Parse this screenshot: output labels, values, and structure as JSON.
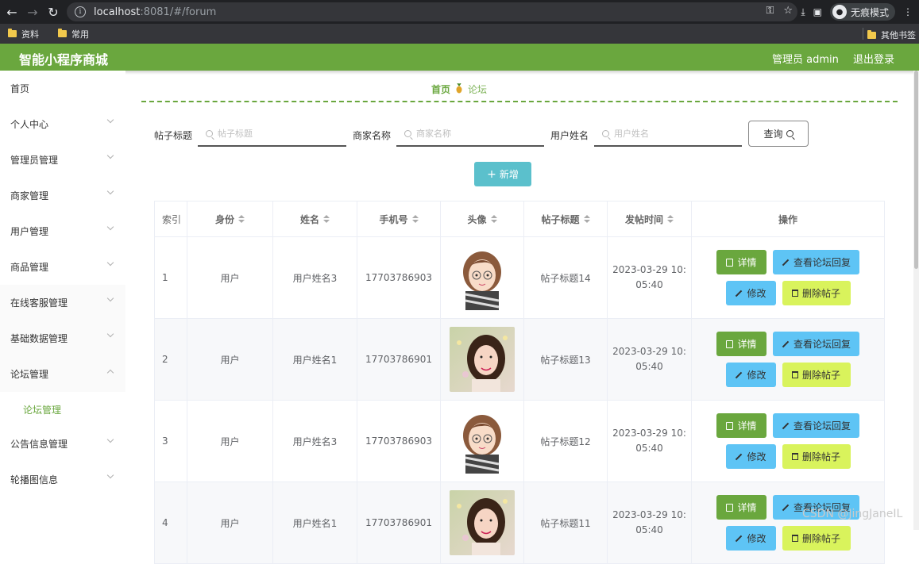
{
  "browser": {
    "url_host": "localhost",
    "url_path": ":8081/#/forum",
    "incognito_label": "无痕模式",
    "bookmarks": [
      "资料",
      "常用"
    ],
    "other_bookmarks": "其他书签"
  },
  "header": {
    "title": "智能小程序商城",
    "admin": "管理员 admin",
    "logout": "退出登录",
    "accent_color": "#6aa73e"
  },
  "sidebar": {
    "items": [
      {
        "label": "首页"
      },
      {
        "label": "个人中心"
      },
      {
        "label": "管理员管理"
      },
      {
        "label": "商家管理"
      },
      {
        "label": "用户管理"
      },
      {
        "label": "商品管理"
      },
      {
        "label": "在线客服管理"
      },
      {
        "label": "基础数据管理"
      },
      {
        "label": "论坛管理"
      },
      {
        "label": "公告信息管理"
      },
      {
        "label": "轮播图信息"
      }
    ],
    "sub_item": "论坛管理"
  },
  "breadcrumb": {
    "home": "首页",
    "current": "论坛"
  },
  "search": {
    "title_label": "帖子标题",
    "title_placeholder": "帖子标题",
    "merchant_label": "商家名称",
    "merchant_placeholder": "商家名称",
    "user_label": "用户姓名",
    "user_placeholder": "用户姓名",
    "query_button": "查询",
    "add_button": "新增"
  },
  "table": {
    "headers": [
      "索引",
      "身份",
      "姓名",
      "手机号",
      "头像",
      "帖子标题",
      "发帖时间",
      "操作"
    ],
    "rows": [
      {
        "index": "1",
        "identity": "用户",
        "name": "用户姓名3",
        "phone": "17703786903",
        "avatar": "cartoon-girl",
        "title": "帖子标题14",
        "time_line1": "2023-03-29 10:",
        "time_line2": "05:40"
      },
      {
        "index": "2",
        "identity": "用户",
        "name": "用户姓名1",
        "phone": "17703786901",
        "avatar": "photo-girl",
        "title": "帖子标题13",
        "time_line1": "2023-03-29 10:",
        "time_line2": "05:40"
      },
      {
        "index": "3",
        "identity": "用户",
        "name": "用户姓名3",
        "phone": "17703786903",
        "avatar": "cartoon-girl",
        "title": "帖子标题12",
        "time_line1": "2023-03-29 10:",
        "time_line2": "05:40"
      },
      {
        "index": "4",
        "identity": "用户",
        "name": "用户姓名1",
        "phone": "17703786901",
        "avatar": "photo-girl",
        "title": "帖子标题11",
        "time_line1": "2023-03-29 10:",
        "time_line2": "05:40"
      }
    ],
    "actions": {
      "detail": "详情",
      "view_replies": "查看论坛回复",
      "edit": "修改",
      "delete": "删除帖子"
    }
  },
  "watermark": "CSDN @JingJaneIL"
}
